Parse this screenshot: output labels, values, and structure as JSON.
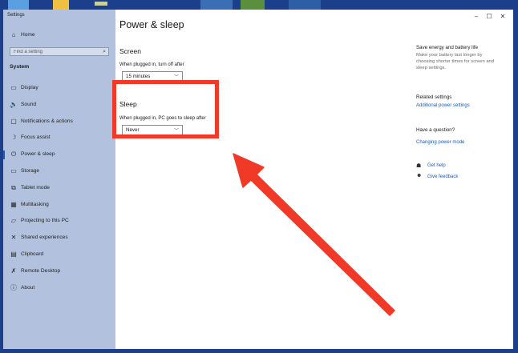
{
  "window": {
    "app_title": "Settings",
    "controls": {
      "minimize": "–",
      "maximize": "☐",
      "close": "✕"
    }
  },
  "sidebar": {
    "home_label": "Home",
    "search_placeholder": "Find a setting",
    "section": "System",
    "items": [
      {
        "label": "Display",
        "icon": "display-icon",
        "glyph": "▭"
      },
      {
        "label": "Sound",
        "icon": "sound-icon",
        "glyph": "🔈"
      },
      {
        "label": "Notifications & actions",
        "icon": "notifications-icon",
        "glyph": "▢"
      },
      {
        "label": "Focus assist",
        "icon": "moon-icon",
        "glyph": "☽"
      },
      {
        "label": "Power & sleep",
        "icon": "power-icon",
        "glyph": "⏻"
      },
      {
        "label": "Storage",
        "icon": "storage-icon",
        "glyph": "▭"
      },
      {
        "label": "Tablet mode",
        "icon": "tablet-icon",
        "glyph": "⧉"
      },
      {
        "label": "Multitasking",
        "icon": "multitasking-icon",
        "glyph": "▦"
      },
      {
        "label": "Projecting to this PC",
        "icon": "projecting-icon",
        "glyph": "▱"
      },
      {
        "label": "Shared experiences",
        "icon": "shared-icon",
        "glyph": "✕"
      },
      {
        "label": "Clipboard",
        "icon": "clipboard-icon",
        "glyph": "▤"
      },
      {
        "label": "Remote Desktop",
        "icon": "remote-desktop-icon",
        "glyph": "✗"
      },
      {
        "label": "About",
        "icon": "info-icon",
        "glyph": "ⓘ"
      }
    ]
  },
  "main": {
    "title": "Power & sleep",
    "screen": {
      "heading": "Screen",
      "label": "When plugged in, turn off after",
      "value": "15 minutes"
    },
    "sleep": {
      "heading": "Sleep",
      "label": "When plugged in, PC goes to sleep after",
      "value": "Never"
    }
  },
  "right": {
    "save_title": "Save energy and battery life",
    "save_text": "Make your battery last longer by choosing shorter times for screen and sleep settings.",
    "related_title": "Related settings",
    "related_link": "Additional power settings",
    "question_title": "Have a question?",
    "question_link": "Changing power mode",
    "help_link": "Get help",
    "feedback_link": "Give feedback"
  },
  "colors": {
    "sidebar_bg": "#b2c2de",
    "accent": "#1a5cb8",
    "annotation_red": "#f03a27"
  }
}
